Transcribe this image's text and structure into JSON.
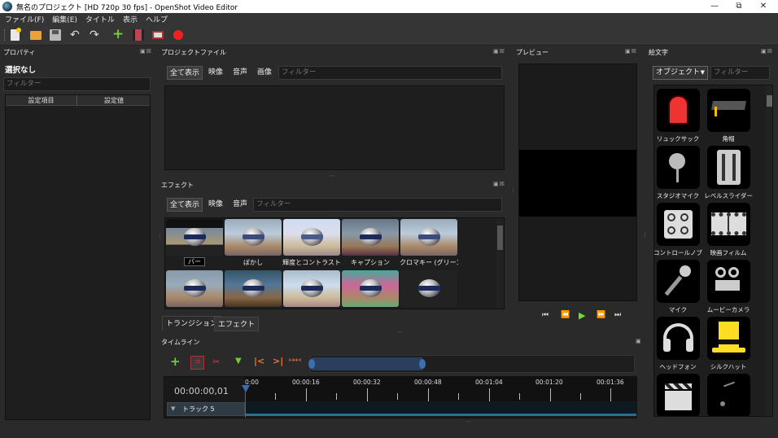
{
  "window": {
    "title": "無名のプロジェクト [HD 720p 30 fps] - OpenShot Video Editor"
  },
  "menu": [
    "ファイル(F)",
    "編集(E)",
    "タイトル",
    "表示",
    "ヘルプ"
  ],
  "properties": {
    "title": "プロパティ",
    "selection": "選択なし",
    "filter_placeholder": "フィルター",
    "col_key": "設定項目",
    "col_value": "設定値"
  },
  "project_files": {
    "title": "プロジェクトファイル",
    "filters": [
      "全て表示",
      "映像",
      "音声",
      "画像"
    ],
    "filter_placeholder": "フィルター"
  },
  "effects": {
    "title": "エフェクト",
    "filters": [
      "全て表示",
      "映像",
      "音声"
    ],
    "filter_placeholder": "フィルター",
    "items": [
      {
        "label": "バー"
      },
      {
        "label": "ぼかし"
      },
      {
        "label": "輝度とコントラスト"
      },
      {
        "label": "キャプション"
      },
      {
        "label": "クロマキー (グリーン..."
      },
      {
        "label": ""
      },
      {
        "label": ""
      },
      {
        "label": ""
      },
      {
        "label": ""
      },
      {
        "label": ""
      }
    ]
  },
  "preview": {
    "title": "プレビュー"
  },
  "emoji": {
    "title": "絵文字",
    "category": "オブジェクト",
    "filter_placeholder": "フィルター",
    "items": [
      {
        "label": "リュックサック"
      },
      {
        "label": "角帽"
      },
      {
        "label": "スタジオマイク"
      },
      {
        "label": "レベルスライダー"
      },
      {
        "label": "コントロールノブ"
      },
      {
        "label": "映画フィルム"
      },
      {
        "label": "マイク"
      },
      {
        "label": "ムービーカメラ"
      },
      {
        "label": "ヘッドフォン"
      },
      {
        "label": "シルクハット"
      },
      {
        "label": ""
      },
      {
        "label": ""
      }
    ]
  },
  "bottom_tabs": [
    "トランジション",
    "エフェクト"
  ],
  "timeline": {
    "title": "タイムライン",
    "timecode": "00:00:00,01",
    "ruler": [
      "0:00",
      "00:00:16",
      "00:00:32",
      "00:00:48",
      "00:01:04",
      "00:01:20",
      "00:01:36"
    ],
    "track": "トラック 5"
  }
}
